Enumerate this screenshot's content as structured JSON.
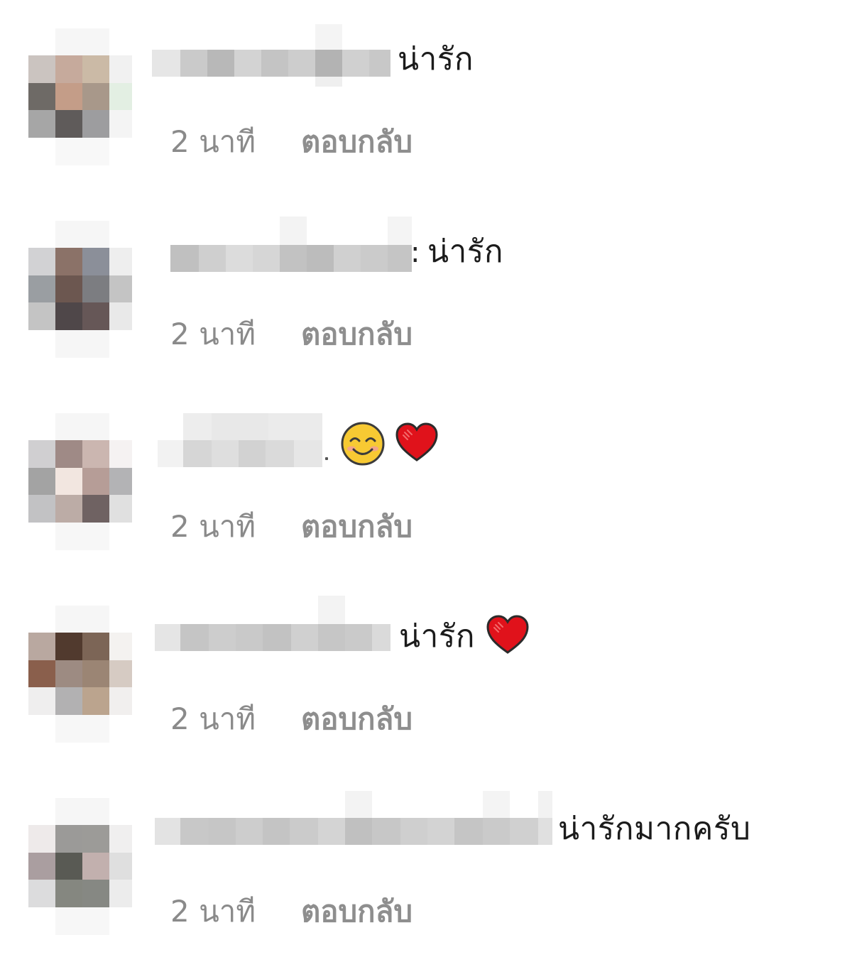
{
  "comments": [
    {
      "text": "น่ารัก",
      "time": "2 นาที",
      "reply": "ตอบกลับ",
      "emojis": []
    },
    {
      "text": "น่ารัก",
      "time": "2 นาที",
      "reply": "ตอบกลับ",
      "emojis": []
    },
    {
      "text": "",
      "time": "2 นาที",
      "reply": "ตอบกลับ",
      "emojis": [
        "smiling-face-emoji",
        "red-heart-emoji"
      ]
    },
    {
      "text": "น่ารัก",
      "time": "2 นาที",
      "reply": "ตอบกลับ",
      "emojis": [
        "red-heart-emoji"
      ]
    },
    {
      "text": "น่ารักมากครับ",
      "time": "2 นาที",
      "reply": "ตอบกลับ",
      "emojis": []
    }
  ],
  "colors": {
    "meta_text": "#8a8a8a",
    "comment_text": "#1b1b1b",
    "heart": "#e0121b",
    "smiley": "#f7c933"
  }
}
